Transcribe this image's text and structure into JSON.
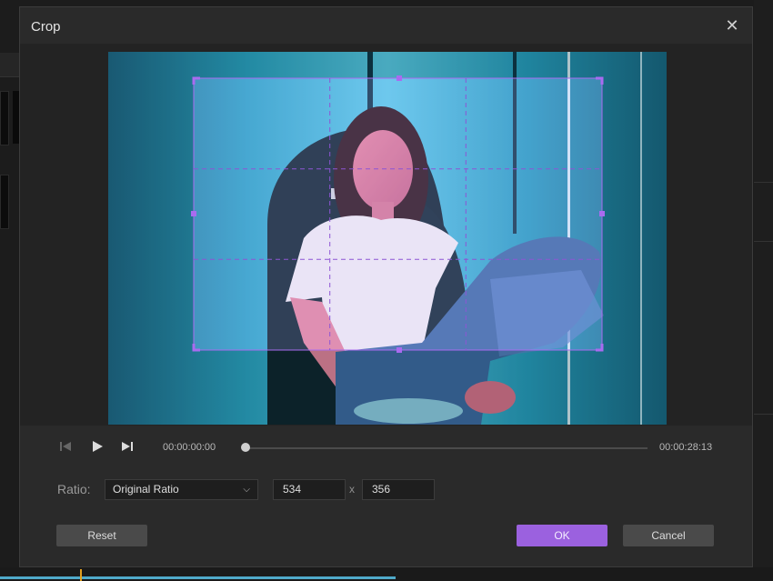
{
  "dialog": {
    "title": "Crop",
    "close_icon": "close-icon"
  },
  "player": {
    "current_time": "00:00:00:00",
    "total_time": "00:00:28:13",
    "progress": 0
  },
  "ratio": {
    "label": "Ratio:",
    "selected": "Original Ratio",
    "width": "534",
    "separator": "x",
    "height": "356"
  },
  "buttons": {
    "reset": "Reset",
    "ok": "OK",
    "cancel": "Cancel"
  },
  "colors": {
    "accent": "#9b61df",
    "crop_border": "#a96bf0"
  },
  "icons": [
    "skip-back-icon",
    "play-icon",
    "skip-forward-icon",
    "chevron-down-icon",
    "close-icon"
  ]
}
